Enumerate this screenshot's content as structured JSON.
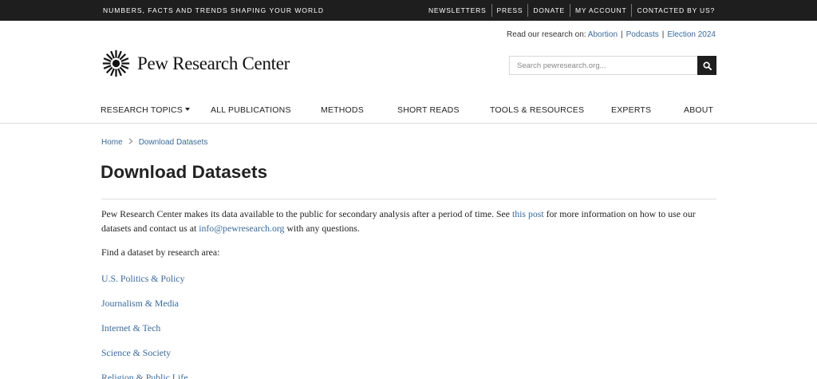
{
  "topbar": {
    "tagline": "Numbers, Facts and Trends Shaping Your World",
    "links": [
      "Newsletters",
      "Press",
      "Donate",
      "My Account",
      "Contacted by us?"
    ]
  },
  "research_on": {
    "label": "Read our research on:",
    "links": [
      "Abortion",
      "Podcasts",
      "Election 2024"
    ]
  },
  "logo": {
    "text": "Pew Research Center"
  },
  "search": {
    "placeholder": "Search pewresearch.org..."
  },
  "nav": {
    "items": [
      "Research Topics",
      "All Publications",
      "Methods",
      "Short Reads",
      "Tools & Resources",
      "Experts",
      "About"
    ]
  },
  "breadcrumb": {
    "home": "Home",
    "current": "Download Datasets"
  },
  "page": {
    "title": "Download Datasets",
    "intro_1": "Pew Research Center makes its data available to the public for secondary analysis after a period of time. See ",
    "intro_link": "this post",
    "intro_2": " for more information on how to use our datasets and contact us at ",
    "intro_email": "info@pewresearch.org",
    "intro_3": " with any questions.",
    "find_label": "Find a dataset by research area:",
    "areas": [
      "U.S. Politics & Policy",
      "Journalism & Media",
      "Internet & Tech",
      "Science & Society",
      "Religion & Public Life"
    ]
  },
  "colors": {
    "link": "#3a6a9b",
    "topbar": "#1e1e1e"
  },
  "icons": {
    "search": "search-icon",
    "logo": "sunburst-logo-icon",
    "breadcrumb_sep": "chevron-right-icon",
    "nav_caret": "caret-down-icon"
  }
}
